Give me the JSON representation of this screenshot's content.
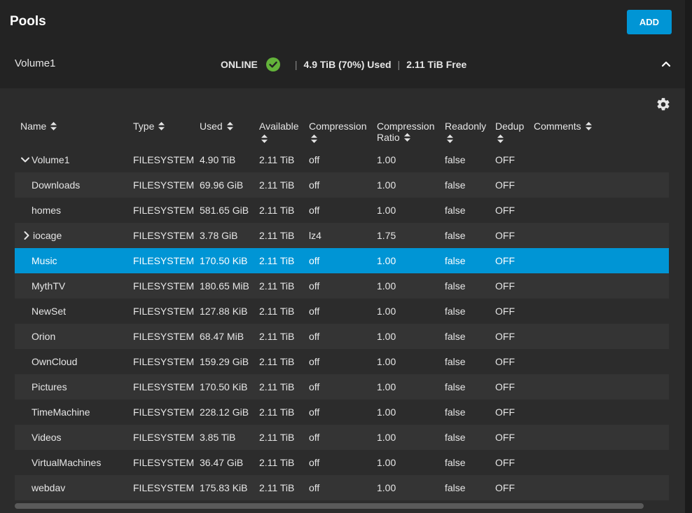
{
  "header": {
    "title": "Pools",
    "add_label": "ADD"
  },
  "pool": {
    "name": "Volume1",
    "status": "ONLINE",
    "used": "4.9 TiB (70%) Used",
    "free": "2.11 TiB Free"
  },
  "colors": {
    "accent": "#0095d5",
    "status_ok": "#63b33a"
  },
  "table": {
    "columns": [
      "Name",
      "Type",
      "Used",
      "Available",
      "Compression",
      "Compression Ratio",
      "Readonly",
      "Dedup",
      "Comments"
    ],
    "rows": [
      {
        "name": "Volume1",
        "type": "FILESYSTEM",
        "used": "4.90 TiB",
        "available": "2.11 TiB",
        "compression": "off",
        "ratio": "1.00",
        "readonly": "false",
        "dedup": "OFF",
        "comments": ""
      },
      {
        "name": "Downloads",
        "type": "FILESYSTEM",
        "used": "69.96 GiB",
        "available": "2.11 TiB",
        "compression": "off",
        "ratio": "1.00",
        "readonly": "false",
        "dedup": "OFF",
        "comments": ""
      },
      {
        "name": "homes",
        "type": "FILESYSTEM",
        "used": "581.65 GiB",
        "available": "2.11 TiB",
        "compression": "off",
        "ratio": "1.00",
        "readonly": "false",
        "dedup": "OFF",
        "comments": ""
      },
      {
        "name": "iocage",
        "type": "FILESYSTEM",
        "used": "3.78 GiB",
        "available": "2.11 TiB",
        "compression": "lz4",
        "ratio": "1.75",
        "readonly": "false",
        "dedup": "OFF",
        "comments": ""
      },
      {
        "name": "Music",
        "type": "FILESYSTEM",
        "used": "170.50 KiB",
        "available": "2.11 TiB",
        "compression": "off",
        "ratio": "1.00",
        "readonly": "false",
        "dedup": "OFF",
        "comments": ""
      },
      {
        "name": "MythTV",
        "type": "FILESYSTEM",
        "used": "180.65 MiB",
        "available": "2.11 TiB",
        "compression": "off",
        "ratio": "1.00",
        "readonly": "false",
        "dedup": "OFF",
        "comments": ""
      },
      {
        "name": "NewSet",
        "type": "FILESYSTEM",
        "used": "127.88 KiB",
        "available": "2.11 TiB",
        "compression": "off",
        "ratio": "1.00",
        "readonly": "false",
        "dedup": "OFF",
        "comments": ""
      },
      {
        "name": "Orion",
        "type": "FILESYSTEM",
        "used": "68.47 MiB",
        "available": "2.11 TiB",
        "compression": "off",
        "ratio": "1.00",
        "readonly": "false",
        "dedup": "OFF",
        "comments": ""
      },
      {
        "name": "OwnCloud",
        "type": "FILESYSTEM",
        "used": "159.29 GiB",
        "available": "2.11 TiB",
        "compression": "off",
        "ratio": "1.00",
        "readonly": "false",
        "dedup": "OFF",
        "comments": ""
      },
      {
        "name": "Pictures",
        "type": "FILESYSTEM",
        "used": "170.50 KiB",
        "available": "2.11 TiB",
        "compression": "off",
        "ratio": "1.00",
        "readonly": "false",
        "dedup": "OFF",
        "comments": ""
      },
      {
        "name": "TimeMachine",
        "type": "FILESYSTEM",
        "used": "228.12 GiB",
        "available": "2.11 TiB",
        "compression": "off",
        "ratio": "1.00",
        "readonly": "false",
        "dedup": "OFF",
        "comments": ""
      },
      {
        "name": "Videos",
        "type": "FILESYSTEM",
        "used": "3.85 TiB",
        "available": "2.11 TiB",
        "compression": "off",
        "ratio": "1.00",
        "readonly": "false",
        "dedup": "OFF",
        "comments": ""
      },
      {
        "name": "VirtualMachines",
        "type": "FILESYSTEM",
        "used": "36.47 GiB",
        "available": "2.11 TiB",
        "compression": "off",
        "ratio": "1.00",
        "readonly": "false",
        "dedup": "OFF",
        "comments": ""
      },
      {
        "name": "webdav",
        "type": "FILESYSTEM",
        "used": "175.83 KiB",
        "available": "2.11 TiB",
        "compression": "off",
        "ratio": "1.00",
        "readonly": "false",
        "dedup": "OFF",
        "comments": ""
      }
    ]
  }
}
